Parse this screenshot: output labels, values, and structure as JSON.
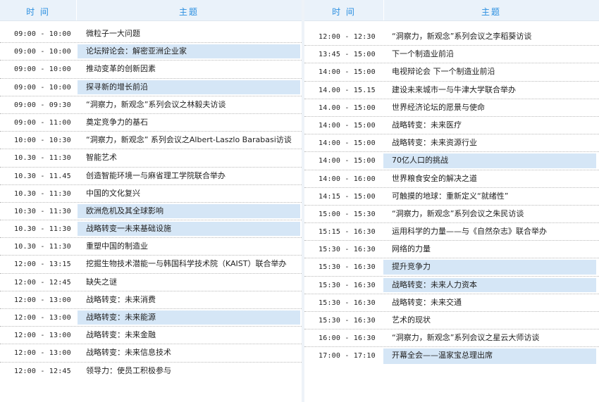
{
  "headers": {
    "time": "时 间",
    "topic": "主题"
  },
  "left": [
    {
      "time": "09:00 - 10:00",
      "topic": "微粒子一大问题",
      "hl": false
    },
    {
      "time": "09:00 - 10:00",
      "topic": "论坛辩论会：解密亚洲企业家",
      "hl": true
    },
    {
      "time": "09:00 - 10:00",
      "topic": "推动变革的创新因素",
      "hl": false
    },
    {
      "time": "09:00 - 10:00",
      "topic": "探寻新的增长前沿",
      "hl": true
    },
    {
      "time": "09:00 - 09:30",
      "topic": "“洞察力，新观念”系列会议之林毅夫访谈",
      "hl": false
    },
    {
      "time": "09:00 - 11:00",
      "topic": "奠定竞争力的基石",
      "hl": false
    },
    {
      "time": "10:00 - 10:30",
      "topic": "“洞察力，新观念” 系列会议之Albert-Laszlo Barabasi访谈",
      "hl": false
    },
    {
      "time": "10.30 - 11:30",
      "topic": "智能艺术",
      "hl": false
    },
    {
      "time": "10.30 - 11.45",
      "topic": "创造智能环境一与麻省理工学院联合举办",
      "hl": false
    },
    {
      "time": "10.30 - 11:30",
      "topic": "中国的文化复兴",
      "hl": false
    },
    {
      "time": "10:30 - 11:30",
      "topic": "欧洲危机及其全球影响",
      "hl": true
    },
    {
      "time": "10.30 - 11:30",
      "topic": "战略转变一未来基础设施",
      "hl": true
    },
    {
      "time": "10.30 - 11:30",
      "topic": "重塑中国的制造业",
      "hl": false
    },
    {
      "time": "12:00 - 13:15",
      "topic": "挖掘生物技术潜能一与韩国科学技术院（KAIST）联合举办",
      "hl": false
    },
    {
      "time": "12:00 - 12:45",
      "topic": "缺失之谜",
      "hl": false
    },
    {
      "time": "12:00 - 13:00",
      "topic": "战略转变：未来消费",
      "hl": false
    },
    {
      "time": "12:00 - 13:00",
      "topic": "战略转变：未来能源",
      "hl": true
    },
    {
      "time": "12:00 - 13:00",
      "topic": "战略转变：未来金融",
      "hl": false
    },
    {
      "time": "12:00 - 13:00",
      "topic": "战略转变：未来信息技术",
      "hl": false
    },
    {
      "time": "12:00 - 12:45",
      "topic": "领导力：使员工积极参与",
      "hl": false
    }
  ],
  "right": [
    {
      "time": "12:00 - 12:30",
      "topic": "“洞察力，新观念”系列会议之李稻葵访谈",
      "hl": false
    },
    {
      "time": "13:45 - 15:00",
      "topic": "下一个制造业前沿",
      "hl": false
    },
    {
      "time": "14:00 - 15:00",
      "topic": "电视辩论会 下一个制造业前沿",
      "hl": false
    },
    {
      "time": "14.00 - 15.15",
      "topic": "建设未来城市一与牛津大学联合举办",
      "hl": false
    },
    {
      "time": "14.00 - 15:00",
      "topic": "世界经济论坛的愿景与使命",
      "hl": false
    },
    {
      "time": "14:00 - 15:00",
      "topic": "战略转变：未来医疗",
      "hl": false
    },
    {
      "time": "14:00 - 15:00",
      "topic": "战略转变：未来资源行业",
      "hl": false
    },
    {
      "time": "14:00 - 15:00",
      "topic": "70亿人口的挑战",
      "hl": true
    },
    {
      "time": "14:00 - 16:00",
      "topic": "世界粮食安全的解决之道",
      "hl": false
    },
    {
      "time": "14:15 - 15:00",
      "topic": "可触摸的地球：重新定义“就绪性”",
      "hl": false
    },
    {
      "time": "15:00 - 15:30",
      "topic": "“洞察力，新观念”系列会议之朱民访谈",
      "hl": false
    },
    {
      "time": "15:15 - 16:30",
      "topic": "运用科学的力量——与《自然杂志》联合举办",
      "hl": false
    },
    {
      "time": "15:30 - 16:30",
      "topic": "网络的力量",
      "hl": false
    },
    {
      "time": "15:30 - 16:30",
      "topic": "提升竞争力",
      "hl": true
    },
    {
      "time": "15:30 - 16:30",
      "topic": "战略转变：未来人力资本",
      "hl": true
    },
    {
      "time": "15:30 - 16:30",
      "topic": "战略转变：未来交通",
      "hl": false
    },
    {
      "time": "15:30 - 16:30",
      "topic": "艺术的现状",
      "hl": false
    },
    {
      "time": "16:00 - 16:30",
      "topic": "“洞察力，新观念”系列会议之星云大师访谈",
      "hl": false
    },
    {
      "time": "17:00 - 17:10",
      "topic": "开幕全会——温家宝总理出席",
      "hl": true
    }
  ]
}
